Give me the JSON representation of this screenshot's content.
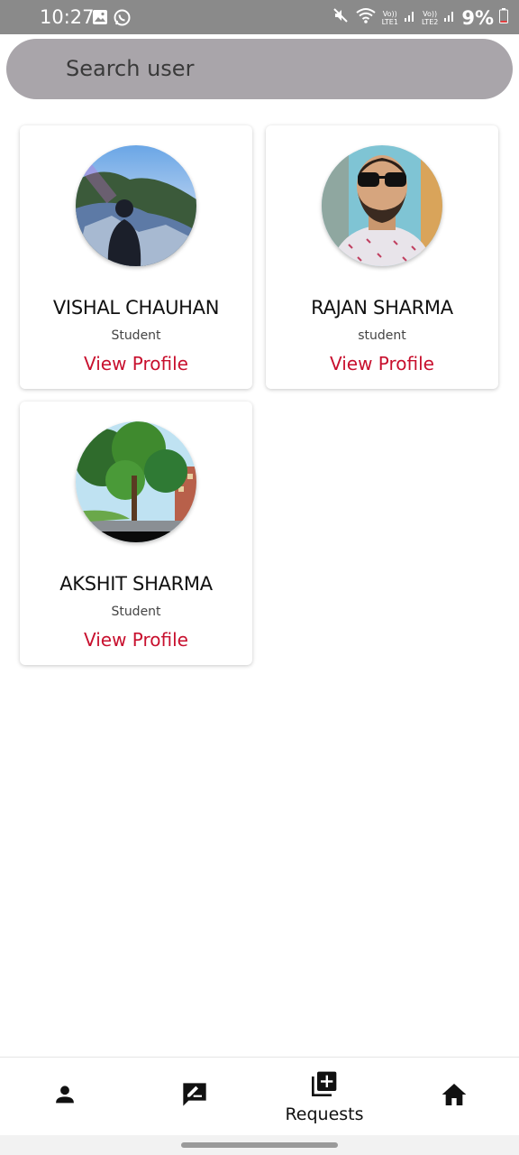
{
  "status_bar": {
    "time": "10:27",
    "battery": "9%",
    "sim1": "LTE1",
    "sim2": "LTE2",
    "volte": "Vo))"
  },
  "search": {
    "placeholder": "Search user"
  },
  "users": [
    {
      "name": "VISHAL CHAUHAN",
      "role": "Student",
      "link": "View Profile"
    },
    {
      "name": "RAJAN SHARMA",
      "role": "student",
      "link": "View Profile"
    },
    {
      "name": "AKSHIT SHARMA",
      "role": "Student",
      "link": "View Profile"
    }
  ],
  "bottom_nav": {
    "items": [
      {
        "icon": "person-icon",
        "label": ""
      },
      {
        "icon": "edit-message-icon",
        "label": ""
      },
      {
        "icon": "add-library-icon",
        "label": "Requests"
      },
      {
        "icon": "home-icon",
        "label": ""
      }
    ]
  },
  "colors": {
    "accent": "#c8102e",
    "search_bg": "#a9a5aa",
    "status_bar_bg": "#8a8a8a"
  }
}
